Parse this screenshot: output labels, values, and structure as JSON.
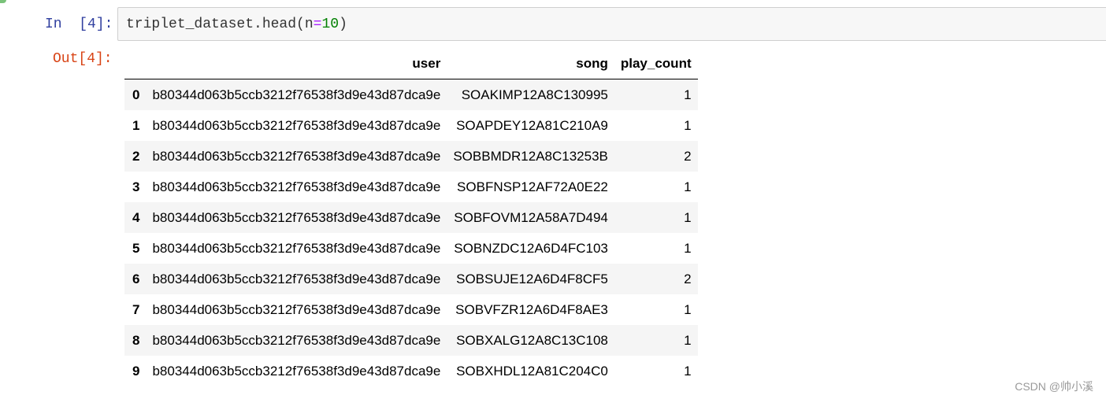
{
  "cells": {
    "input": {
      "prompt": "In  [4]:",
      "code": {
        "prefix": "triplet_dataset.head(n",
        "operator": "=",
        "number": "10",
        "suffix": ")"
      }
    },
    "output": {
      "prompt": "Out[4]:"
    }
  },
  "dataframe": {
    "index_header": "",
    "columns": [
      "user",
      "song",
      "play_count"
    ],
    "rows": [
      {
        "index": "0",
        "user": "b80344d063b5ccb3212f76538f3d9e43d87dca9e",
        "song": "SOAKIMP12A8C130995",
        "play_count": "1"
      },
      {
        "index": "1",
        "user": "b80344d063b5ccb3212f76538f3d9e43d87dca9e",
        "song": "SOAPDEY12A81C210A9",
        "play_count": "1"
      },
      {
        "index": "2",
        "user": "b80344d063b5ccb3212f76538f3d9e43d87dca9e",
        "song": "SOBBMDR12A8C13253B",
        "play_count": "2"
      },
      {
        "index": "3",
        "user": "b80344d063b5ccb3212f76538f3d9e43d87dca9e",
        "song": "SOBFNSP12AF72A0E22",
        "play_count": "1"
      },
      {
        "index": "4",
        "user": "b80344d063b5ccb3212f76538f3d9e43d87dca9e",
        "song": "SOBFOVM12A58A7D494",
        "play_count": "1"
      },
      {
        "index": "5",
        "user": "b80344d063b5ccb3212f76538f3d9e43d87dca9e",
        "song": "SOBNZDC12A6D4FC103",
        "play_count": "1"
      },
      {
        "index": "6",
        "user": "b80344d063b5ccb3212f76538f3d9e43d87dca9e",
        "song": "SOBSUJE12A6D4F8CF5",
        "play_count": "2"
      },
      {
        "index": "7",
        "user": "b80344d063b5ccb3212f76538f3d9e43d87dca9e",
        "song": "SOBVFZR12A6D4F8AE3",
        "play_count": "1"
      },
      {
        "index": "8",
        "user": "b80344d063b5ccb3212f76538f3d9e43d87dca9e",
        "song": "SOBXALG12A8C13C108",
        "play_count": "1"
      },
      {
        "index": "9",
        "user": "b80344d063b5ccb3212f76538f3d9e43d87dca9e",
        "song": "SOBXHDL12A81C204C0",
        "play_count": "1"
      }
    ]
  },
  "watermark": "CSDN @帅小溪",
  "colors": {
    "in_prompt": "#303f9f",
    "out_prompt": "#d84315",
    "code_operator": "#aa22ff",
    "code_number": "#008000",
    "input_background": "#f7f7f7",
    "row_stripe": "#f5f5f5"
  }
}
